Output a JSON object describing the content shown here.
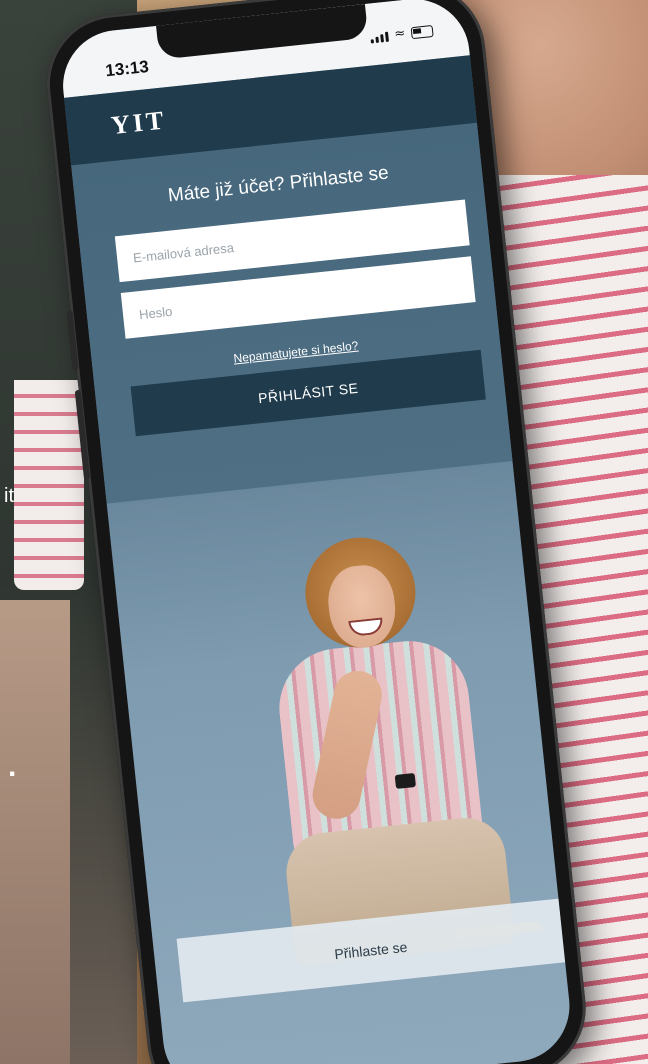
{
  "status_bar": {
    "time": "13:13"
  },
  "header": {
    "logo_text": "YIT"
  },
  "login": {
    "title": "Máte již účet? Přihlaste se",
    "email_placeholder": "E-mailová adresa",
    "password_placeholder": "Heslo",
    "forgot_link": "Nepamatujete si heslo?",
    "submit_label": "PŘIHLÁSIT SE"
  },
  "footer": {
    "signin_label": "Přihlaste se"
  },
  "background": {
    "fragment_1": "it",
    "fragment_2": "."
  },
  "colors": {
    "header": "#1f3b4c",
    "panel": "#4f6f84",
    "button": "#1f3b4c",
    "screen_bg": "#7e9bb0"
  },
  "icons": [
    "signal-icon",
    "wifi-icon",
    "battery-icon"
  ]
}
